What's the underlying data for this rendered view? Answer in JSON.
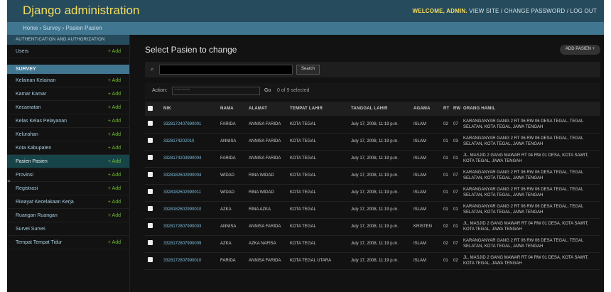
{
  "header": {
    "brand": "Django administration",
    "user_greeting": "WELCOME, ADMIN.",
    "links": [
      "VIEW SITE",
      "CHANGE PASSWORD",
      "LOG OUT"
    ]
  },
  "breadcrumb": "Home › Survey › Pasien Pasien",
  "sidebar": {
    "auth_caption": "AUTHENTICATION AND AUTHORIZATION",
    "auth_items": [
      {
        "label": "Users",
        "add": "+ Add"
      }
    ],
    "app_caption": "SURVEY",
    "app_items": [
      {
        "label": "Kelainan Kelainan",
        "add": "+ Add"
      },
      {
        "label": "Kamar Kamar",
        "add": "+ Add"
      },
      {
        "label": "Kecamatan",
        "add": "+ Add"
      },
      {
        "label": "Kelas Kelas Pelayanan",
        "add": "+ Add"
      },
      {
        "label": "Kelurahan",
        "add": "+ Add"
      },
      {
        "label": "Kota Kabupaten",
        "add": "+ Add"
      },
      {
        "label": "Pasien Pasien",
        "add": "+ Add"
      },
      {
        "label": "Provinsi",
        "add": "+ Add"
      },
      {
        "label": "Registrasi",
        "add": "+ Add"
      },
      {
        "label": "Riwayat Kecelakaan Kerja",
        "add": "+ Add"
      },
      {
        "label": "Ruangan Ruangan",
        "add": "+ Add"
      },
      {
        "label": "Survei Survei",
        "add": ""
      },
      {
        "label": "Tempat Tempat Tidur",
        "add": "+ Add"
      }
    ],
    "toggle": "«"
  },
  "main": {
    "title": "Select Pasien to change",
    "add_button": "ADD PASIEN +",
    "search_placeholder": "",
    "search_button": "Search",
    "action_label": "Action:",
    "action_value": "---------",
    "go_label": "Go",
    "selected_count": "0 of 9 selected"
  },
  "table": {
    "headers": [
      "",
      "NIK",
      "NAMA",
      "ALAMAT",
      "TEMPAT LAHIR",
      "TANGGAL LAHIR",
      "AGAMA",
      "RT",
      "RW",
      "ORANG HAMIL"
    ],
    "rows": [
      [
        "",
        "3328172407990001",
        "FARIDA",
        "ANNISA FARIDA",
        "KOTA TEGAL",
        "July 17, 2008, 11:19 p.m.",
        "ISLAM",
        "02",
        "07",
        "KARANGANYAR GANG 2 RT 06 RW 06 DESA TEGAL, TEGAL SELATAN, KOTA TEGAL, JAWA TENGAH"
      ],
      [
        "",
        "3328174202010",
        "ANNISA",
        "ANNISA FARIDA",
        "KOTA TEGAL",
        "July 17, 2008, 11:19 p.m.",
        "ISLAM",
        "01",
        "03",
        "KARANGANYAR GANG 2 RT 06 RW 06 DESA TEGAL, TEGAL SELATAN, KOTA TEGAL, JAWA TENGAH"
      ],
      [
        "",
        "3328174203990004",
        "FARIDA",
        "ANNISA FARIDA",
        "KOTA TEGAL",
        "July 17, 2008, 11:19 p.m.",
        "ISLAM",
        "01",
        "01",
        "JL. MASJID 2 GANG MAWAR RT 04 RW 01 DESA, KOTA SAWIT, KOTA TEGAL, JAWA TENGAH"
      ],
      [
        "",
        "3328182602990004",
        "WIDAD",
        "RINA WIDAD",
        "KOTA TEGAL",
        "July 17, 2008, 11:19 p.m.",
        "ISLAM",
        "01",
        "07",
        "KARANGANYAR GANG 2 RT 06 RW 06 DESA TEGAL, TEGAL SELATAN, KOTA TEGAL, JAWA TENGAH"
      ],
      [
        "",
        "3328182602990011",
        "WIDAD",
        "RINA WIDAD",
        "KOTA TEGAL",
        "July 17, 2008, 11:19 p.m.",
        "ISLAM",
        "01",
        "07",
        "KARANGANYAR GANG 2 RT 06 RW 06 DESA TEGAL, TEGAL SELATAN, KOTA TEGAL, JAWA TENGAH"
      ],
      [
        "",
        "3328182602990010",
        "AZKA",
        "RINA AZKA",
        "KOTA TEGAL",
        "July 17, 2008, 11:19 p.m.",
        "ISLAM",
        "01",
        "01",
        "KARANGANYAR GANG 2 RT 06 RW 06 DESA TEGAL, TEGAL SELATAN, KOTA TEGAL, JAWA TENGAH"
      ],
      [
        "",
        "3328172807990003",
        "ANNISA",
        "ANNISA FARIDA",
        "KOTA TEGAL",
        "July 17, 2008, 11:19 p.m.",
        "KRISTEN",
        "02",
        "01",
        "JL. MASJID 2 GANG MAWAR RT 04 RW 01 DESA, KOTA SAWIT, KOTA TEGAL, JAWA TENGAH"
      ],
      [
        "",
        "3328172807990009",
        "AZKA",
        "AZKA NAFISA",
        "KOTA TEGAL",
        "July 17, 2008, 11:19 p.m.",
        "ISLAM",
        "02",
        "07",
        "KARANGANYAR GANG 2 RT 06 RW 06 DESA TEGAL, TEGAL SELATAN, KOTA TEGAL, JAWA TENGAH"
      ],
      [
        "",
        "3328172807990010",
        "FARIDA",
        "ANNISA FARIDA",
        "KOTA TEGAL UTARA",
        "July 17, 2008, 11:19 p.m.",
        "ISLAM",
        "01",
        "02",
        "JL. MASJID 2 GANG MAWAR RT 04 RW 01 DESA, KOTA SAWIT, KOTA TEGAL, JAWA TENGAH"
      ]
    ]
  }
}
